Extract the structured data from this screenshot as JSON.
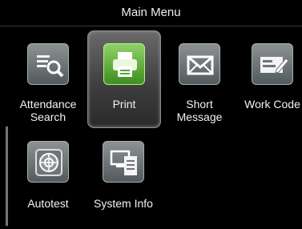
{
  "header": {
    "title": "Main Menu"
  },
  "menu": {
    "items": [
      {
        "label": "Attendance\nSearch",
        "icon": "attendance-search-icon"
      },
      {
        "label": "Print",
        "icon": "print-icon",
        "selected": true
      },
      {
        "label": "Short\nMessage",
        "icon": "message-icon"
      },
      {
        "label": "Work Code",
        "icon": "work-code-icon"
      },
      {
        "label": "Autotest",
        "icon": "autotest-icon"
      },
      {
        "label": "System Info",
        "icon": "system-info-icon"
      }
    ]
  }
}
